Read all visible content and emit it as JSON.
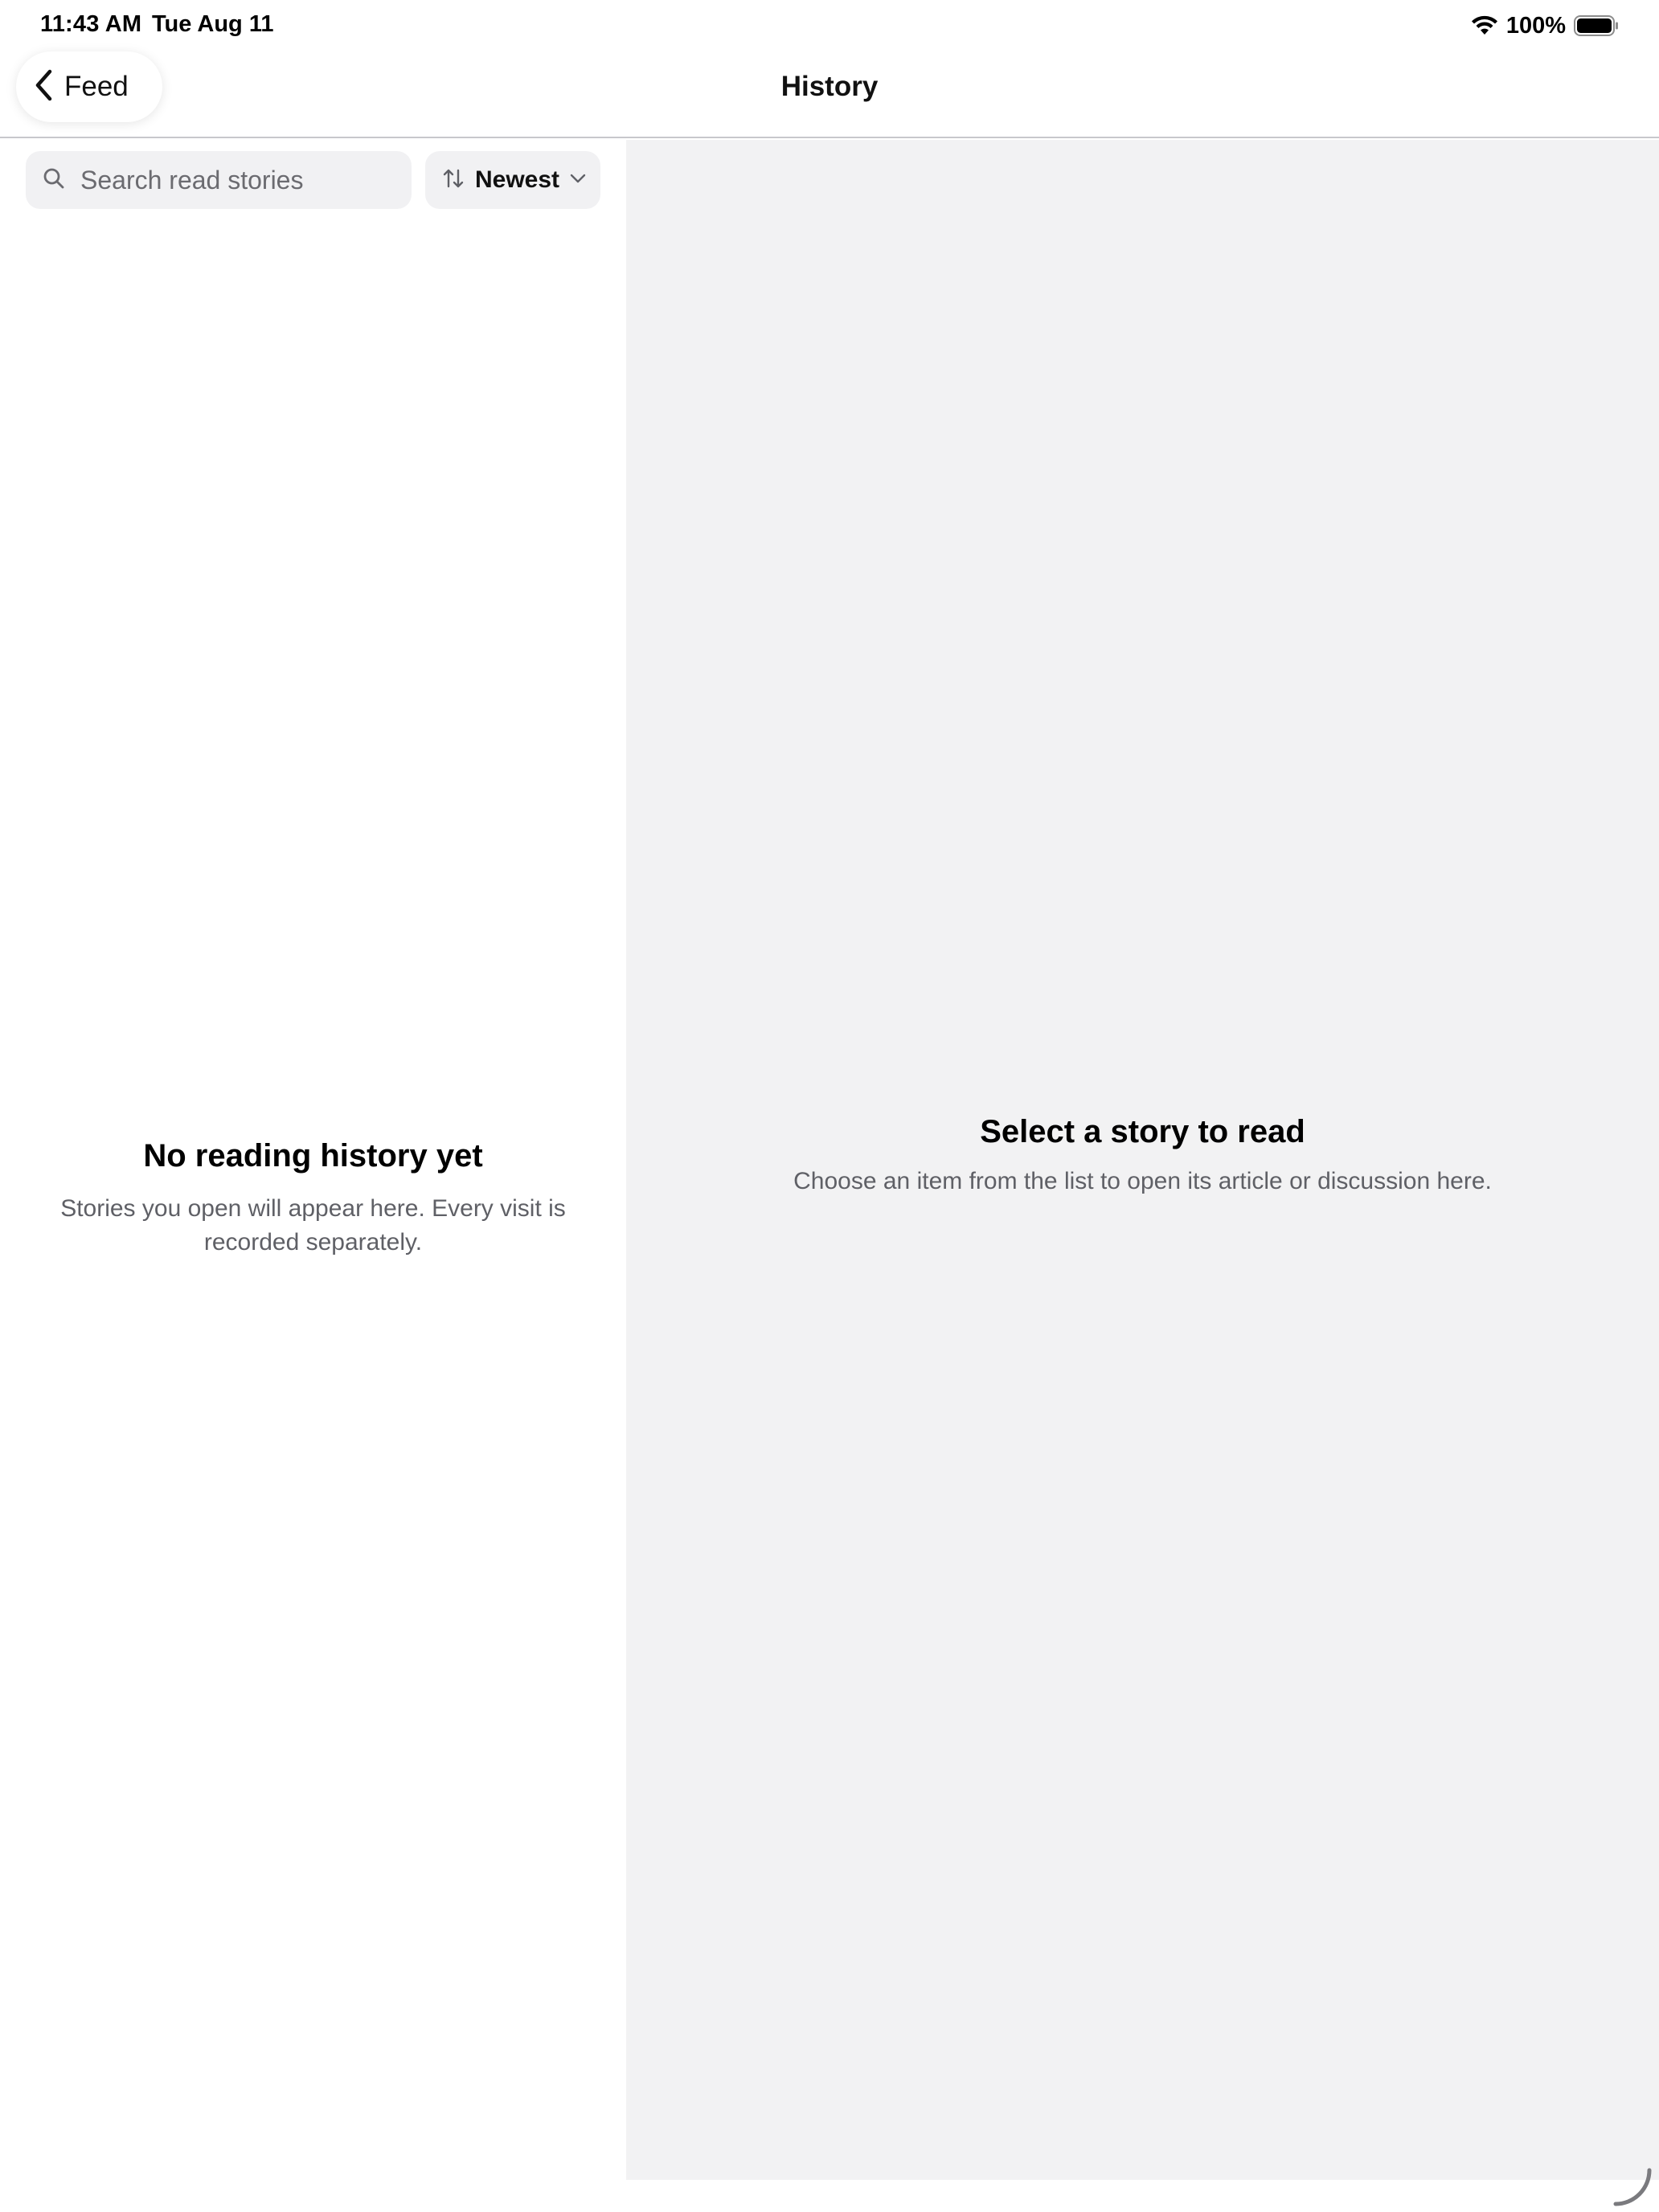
{
  "status_bar": {
    "time": "11:43 AM",
    "date": "Tue Aug 11",
    "battery_percent": "100%",
    "wifi_icon": "wifi-icon",
    "battery_icon": "battery-full-icon"
  },
  "nav": {
    "back_label": "Feed",
    "back_icon": "chevron-left-icon",
    "title": "History"
  },
  "sidebar": {
    "search": {
      "placeholder": "Search read stories",
      "value": "",
      "icon": "search-icon"
    },
    "sort": {
      "label": "Newest",
      "icon": "sort-arrows-icon",
      "chevron": "chevron-down-icon"
    },
    "empty_state": {
      "title": "No reading history yet",
      "body": "Stories you open will appear here. Every visit is recorded separately."
    }
  },
  "detail": {
    "empty_state": {
      "title": "Select a story to read",
      "body": "Choose an item from the list to open its article or discussion here."
    }
  },
  "colors": {
    "background": "#ffffff",
    "detail_background": "#f2f2f3",
    "field_background": "#f1f1f3",
    "secondary_text": "#5f6066",
    "divider": "#c8c8cc"
  }
}
